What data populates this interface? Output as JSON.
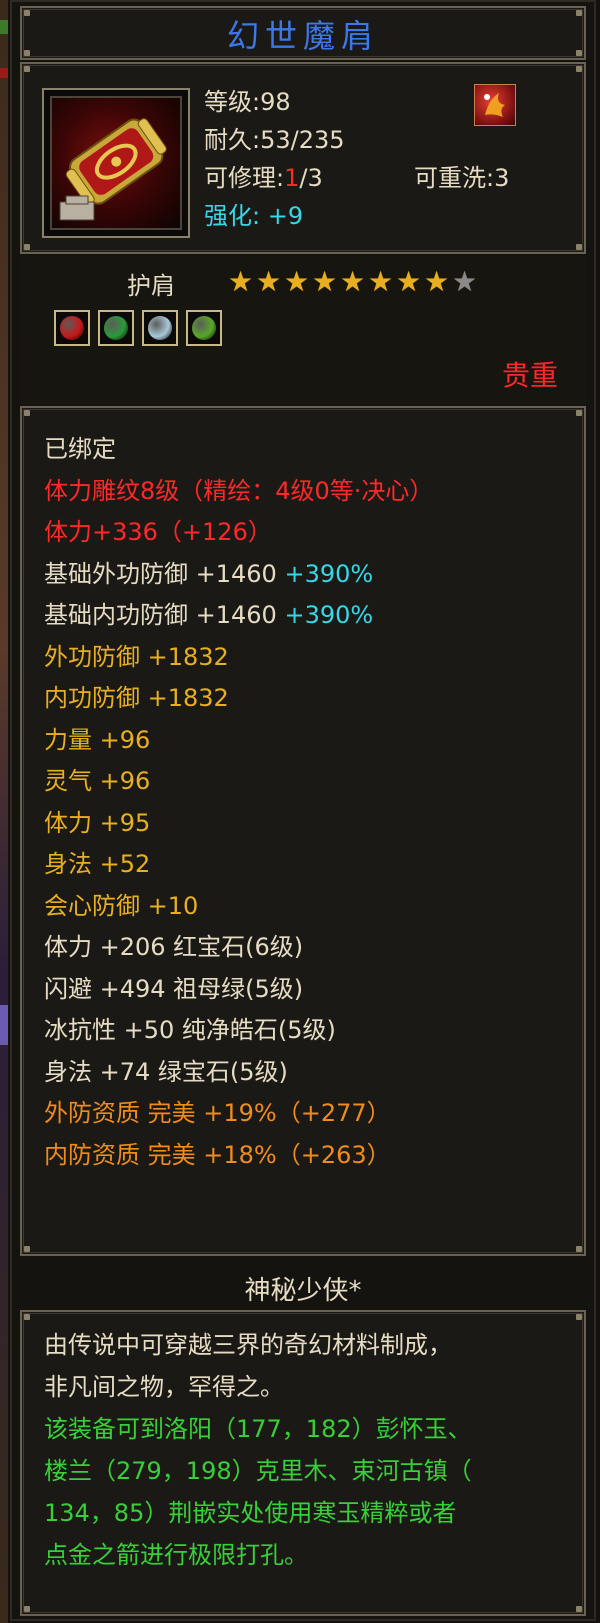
{
  "item": {
    "name": "幻世魔肩",
    "level": "等级:98",
    "durability": "耐久:53/235",
    "repair_label": "可修理:",
    "repair_used": "1",
    "repair_total": "/3",
    "rewash": "可重洗:3",
    "enhance": "强化: +9",
    "type": "护肩",
    "stars_filled": 8,
    "stars_total": 9,
    "rarity": "贵重"
  },
  "gems": [
    {
      "name": "red-gem",
      "color": "#c81818"
    },
    {
      "name": "emerald-gem",
      "color": "#2a9a3a"
    },
    {
      "name": "white-gem",
      "color": "#a8c8d8"
    },
    {
      "name": "green-gem",
      "color": "#58a828"
    }
  ],
  "stats": [
    {
      "segments": [
        {
          "text": "已绑定",
          "color": "white"
        }
      ]
    },
    {
      "segments": [
        {
          "text": "体力雕纹8级（精绘：4级0等·决心）",
          "color": "red"
        }
      ]
    },
    {
      "segments": [
        {
          "text": "体力+336（+126）",
          "color": "red"
        }
      ]
    },
    {
      "segments": [
        {
          "text": "基础外功防御 +1460 ",
          "color": "white"
        },
        {
          "text": "+390%",
          "color": "cyan"
        }
      ]
    },
    {
      "segments": [
        {
          "text": "基础内功防御 +1460 ",
          "color": "white"
        },
        {
          "text": "+390%",
          "color": "cyan"
        }
      ]
    },
    {
      "segments": [
        {
          "text": "外功防御 +1832",
          "color": "gold"
        }
      ]
    },
    {
      "segments": [
        {
          "text": "内功防御 +1832",
          "color": "gold"
        }
      ]
    },
    {
      "segments": [
        {
          "text": "力量 +96",
          "color": "gold"
        }
      ]
    },
    {
      "segments": [
        {
          "text": "灵气 +96",
          "color": "gold"
        }
      ]
    },
    {
      "segments": [
        {
          "text": "体力 +95",
          "color": "gold"
        }
      ]
    },
    {
      "segments": [
        {
          "text": "身法 +52",
          "color": "gold"
        }
      ]
    },
    {
      "segments": [
        {
          "text": "会心防御 +10",
          "color": "gold"
        }
      ]
    },
    {
      "segments": [
        {
          "text": "体力 +206 红宝石(6级)",
          "color": "white"
        }
      ]
    },
    {
      "segments": [
        {
          "text": "闪避 +494 祖母绿(5级)",
          "color": "white"
        }
      ]
    },
    {
      "segments": [
        {
          "text": "冰抗性 +50 纯净皓石(5级)",
          "color": "white"
        }
      ]
    },
    {
      "segments": [
        {
          "text": "身法 +74 绿宝石(5级)",
          "color": "white"
        }
      ]
    },
    {
      "segments": [
        {
          "text": "外防资质  完美 +19%（+277）",
          "color": "orange"
        }
      ]
    },
    {
      "segments": [
        {
          "text": "内防资质  完美 +18%（+263）",
          "color": "orange"
        }
      ]
    }
  ],
  "maker": "神秘少侠*",
  "description": [
    {
      "text": "由传说中可穿越三界的奇幻材料制成，",
      "color": "white"
    },
    {
      "text": "非凡间之物，罕得之。",
      "color": "white"
    },
    {
      "text": "该装备可到洛阳（177，182）彭怀玉、",
      "color": "green"
    },
    {
      "text": "楼兰（279，198）克里木、束河古镇（",
      "color": "green"
    },
    {
      "text": "134，85）荆嵌实处使用寒玉精粹或者",
      "color": "green"
    },
    {
      "text": "点金之箭进行极限打孔。",
      "color": "green"
    }
  ]
}
